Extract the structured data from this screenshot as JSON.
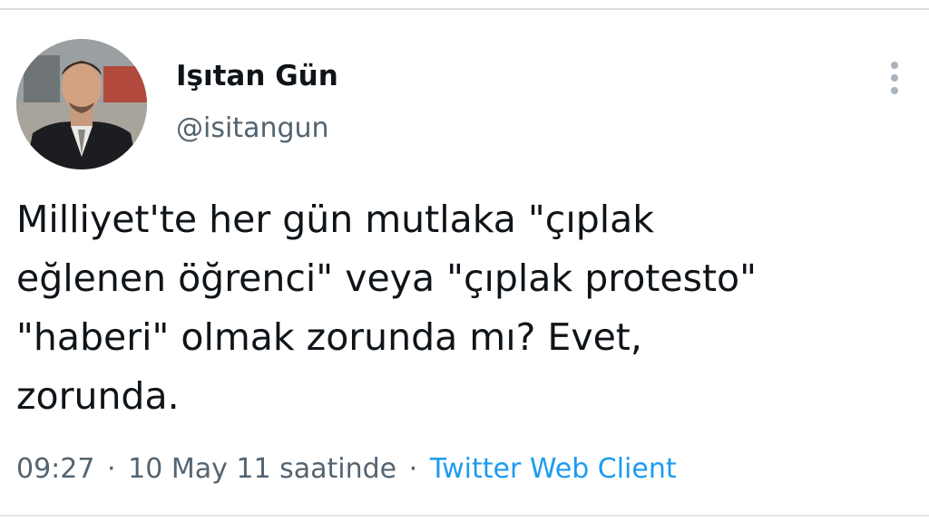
{
  "user": {
    "display_name": "Işıtan Gün",
    "handle": "@isitangun",
    "avatar_icon": "profile-photo"
  },
  "more_icon": "more-vertical-icon",
  "tweet": {
    "text": "Milliyet'te her gün mutlaka \"çıplak\neğlenen öğrenci\" veya \"çıplak protesto\"\n\"haberi\" olmak zorunda mı? Evet,\nzorunda.",
    "time": "09:27",
    "separator": "·",
    "date": "10 May 11 saatinde",
    "source": "Twitter Web Client"
  },
  "colors": {
    "text_primary": "#0f1419",
    "text_secondary": "#536471",
    "link": "#1d9bf0"
  }
}
